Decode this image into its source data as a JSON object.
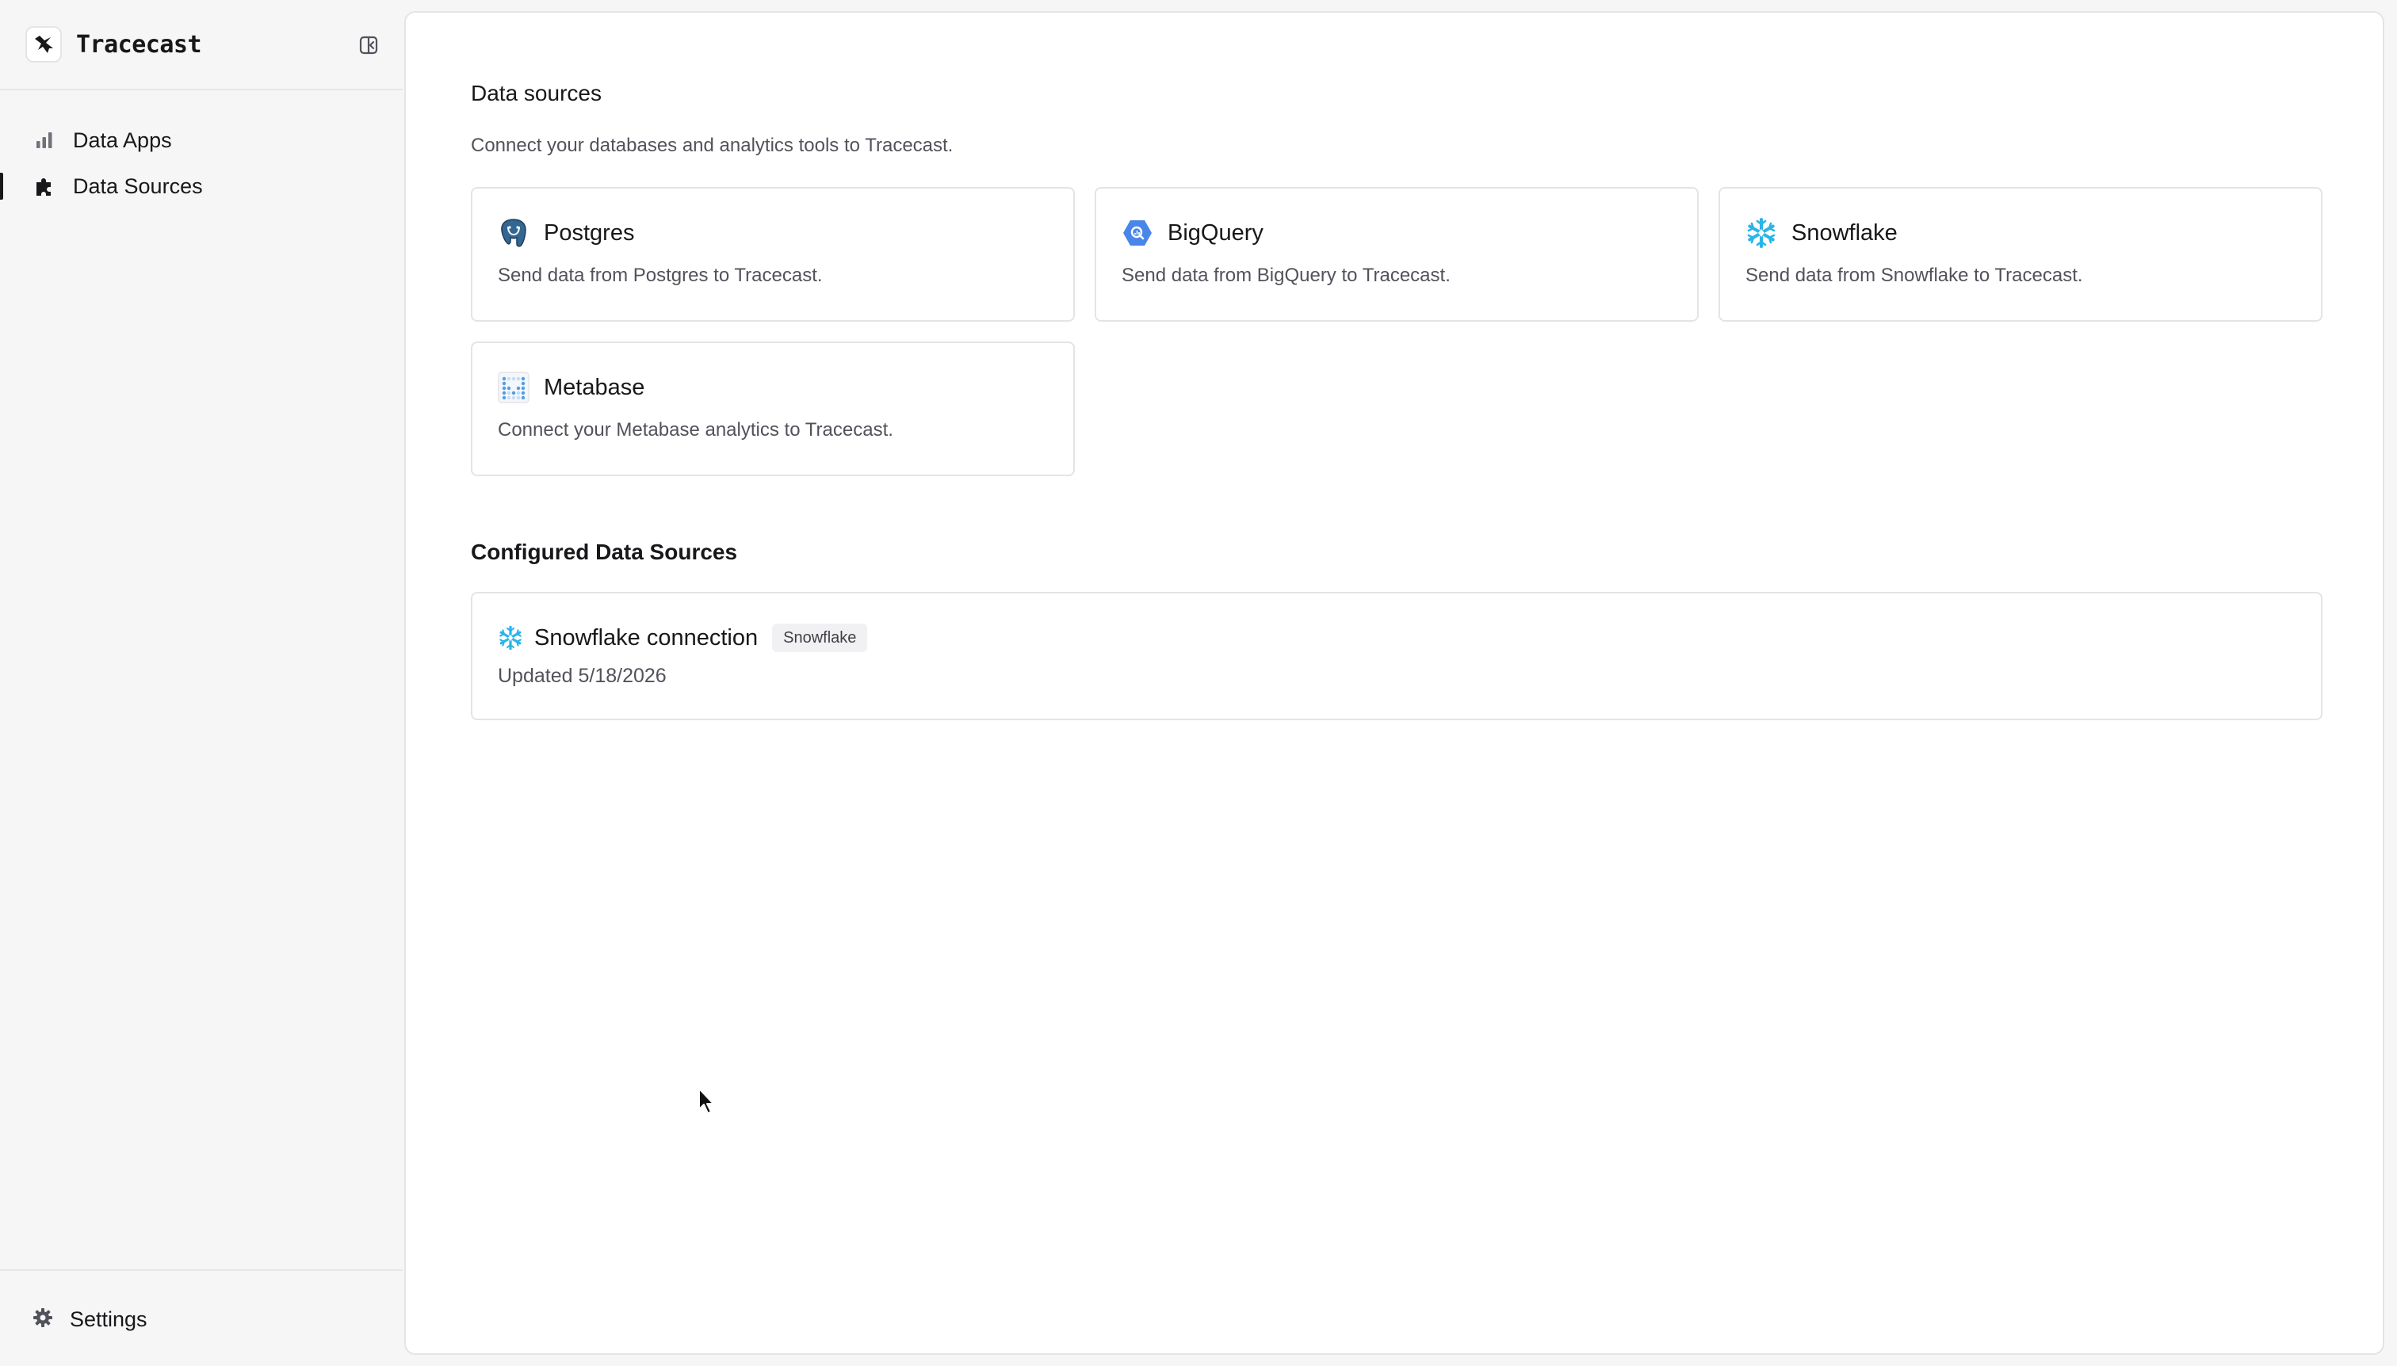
{
  "app": {
    "name": "Tracecast"
  },
  "sidebar": {
    "items": [
      {
        "label": "Data Apps",
        "icon": "bar-chart-icon",
        "active": false
      },
      {
        "label": "Data Sources",
        "icon": "puzzle-icon",
        "active": true
      }
    ],
    "settings_label": "Settings"
  },
  "main": {
    "data_sources_title": "Data sources",
    "data_sources_subtitle": "Connect your databases and analytics tools to Tracecast.",
    "sources": [
      {
        "name": "Postgres",
        "description": "Send data from Postgres to Tracecast.",
        "icon": "postgres-icon"
      },
      {
        "name": "BigQuery",
        "description": "Send data from BigQuery to Tracecast.",
        "icon": "bigquery-icon"
      },
      {
        "name": "Snowflake",
        "description": "Send data from Snowflake to Tracecast.",
        "icon": "snowflake-icon"
      },
      {
        "name": "Metabase",
        "description": "Connect your Metabase analytics to Tracecast.",
        "icon": "metabase-icon"
      }
    ],
    "configured_title": "Configured Data Sources",
    "configured": [
      {
        "name": "Snowflake connection",
        "badge": "Snowflake",
        "updated": "Updated 5/18/2026",
        "icon": "snowflake-icon"
      }
    ]
  },
  "colors": {
    "snowflake": "#29b5e8",
    "bigquery": "#4a86e8",
    "postgres": "#336791",
    "metabase": "#509ee3"
  }
}
